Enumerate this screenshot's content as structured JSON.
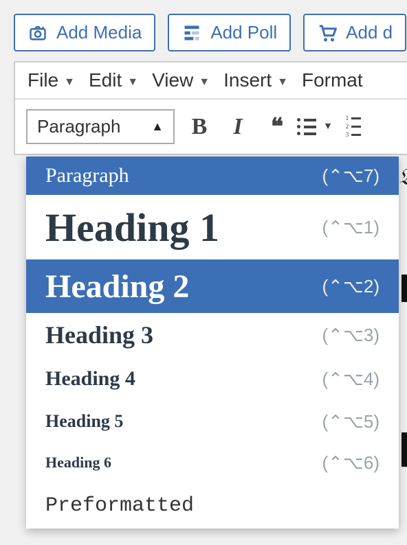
{
  "actions": {
    "media": "Add Media",
    "poll": "Add Poll",
    "deal": "Add d"
  },
  "menubar": {
    "file": "File",
    "edit": "Edit",
    "view": "View",
    "insert": "Insert",
    "format": "Format"
  },
  "toolbar": {
    "format_current": "Paragraph"
  },
  "dropdown": {
    "items": [
      {
        "label": "Paragraph",
        "shortcut": "(⌃⌥7)",
        "style": "dd-paragraph",
        "highlight": true
      },
      {
        "label": "Heading 1",
        "shortcut": "(⌃⌥1)",
        "style": "dd-h1",
        "highlight": false
      },
      {
        "label": "Heading 2",
        "shortcut": "(⌃⌥2)",
        "style": "dd-h2",
        "highlight": true
      },
      {
        "label": "Heading 3",
        "shortcut": "(⌃⌥3)",
        "style": "dd-h3",
        "highlight": false
      },
      {
        "label": "Heading 4",
        "shortcut": "(⌃⌥4)",
        "style": "dd-h4",
        "highlight": false
      },
      {
        "label": "Heading 5",
        "shortcut": "(⌃⌥5)",
        "style": "dd-h5",
        "highlight": false
      },
      {
        "label": "Heading 6",
        "shortcut": "(⌃⌥6)",
        "style": "dd-h6",
        "highlight": false
      },
      {
        "label": "Preformatted",
        "shortcut": "",
        "style": "dd-pre",
        "highlight": false
      }
    ]
  }
}
